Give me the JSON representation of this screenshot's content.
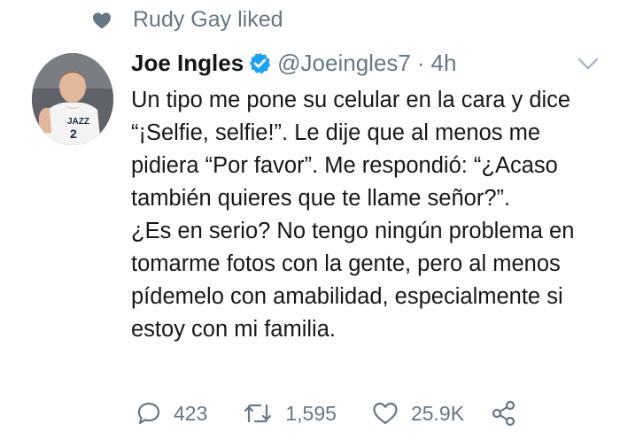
{
  "social_context": {
    "icon": "heart-icon",
    "text": "Rudy Gay liked"
  },
  "tweet": {
    "author_name": "Joe Ingles",
    "verified_icon": "verified-badge-icon",
    "handle": "@Joeingles7",
    "separator": "·",
    "time": "4h",
    "paragraphs": [
      "Un tipo me pone su celular en la cara y dice “¡Selfie, selfie!”. Le dije que al menos me pidiera “Por favor”. Me respondió: “¿Acaso también quieres que te llame señor?”.",
      "¿Es en serio? No tengo ningún problema en tomarme fotos con la gente, pero al menos pídemelo con amabilidad, especialmente si estoy con mi familia."
    ]
  },
  "actions": {
    "reply_count": "423",
    "retweet_count": "1,595",
    "like_count": "25.9K"
  },
  "colors": {
    "text": "#14171a",
    "secondary": "#657786",
    "verified": "#1da1f2",
    "background": "#ffffff"
  }
}
